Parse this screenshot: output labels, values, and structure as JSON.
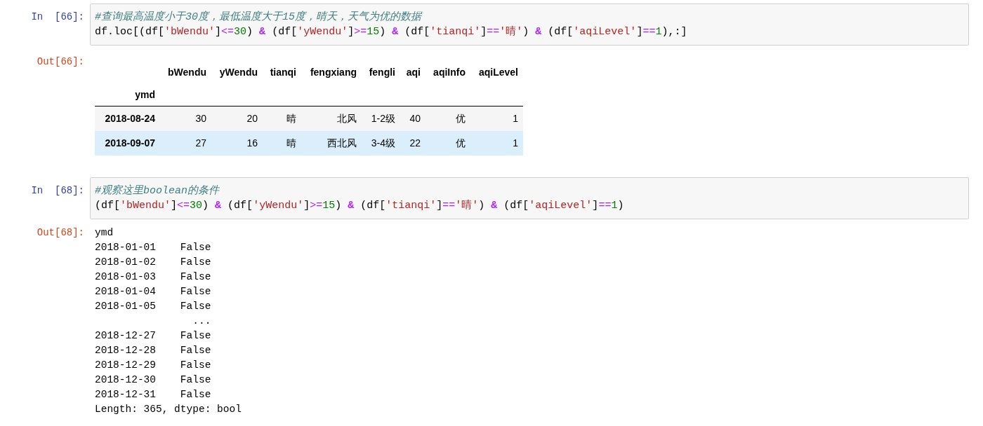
{
  "cells": [
    {
      "kind": "code",
      "prompt": "In  [66]:",
      "lines": [
        [
          {
            "kind": "comment",
            "text": "#查询最高温度小于30度，最低温度大于15度，晴天，天气为优的数据"
          }
        ],
        [
          {
            "kind": "plain",
            "text": "df.loc[(df["
          },
          {
            "kind": "string",
            "text": "'bWendu'"
          },
          {
            "kind": "plain",
            "text": "]"
          },
          {
            "kind": "op",
            "text": "<="
          },
          {
            "kind": "number",
            "text": "30"
          },
          {
            "kind": "plain",
            "text": ") "
          },
          {
            "kind": "amp",
            "text": "&"
          },
          {
            "kind": "plain",
            "text": " (df["
          },
          {
            "kind": "string",
            "text": "'yWendu'"
          },
          {
            "kind": "plain",
            "text": "]"
          },
          {
            "kind": "op",
            "text": ">="
          },
          {
            "kind": "number",
            "text": "15"
          },
          {
            "kind": "plain",
            "text": ") "
          },
          {
            "kind": "amp",
            "text": "&"
          },
          {
            "kind": "plain",
            "text": " (df["
          },
          {
            "kind": "string",
            "text": "'tianqi'"
          },
          {
            "kind": "plain",
            "text": "]"
          },
          {
            "kind": "op",
            "text": "=="
          },
          {
            "kind": "string",
            "text": "'晴'"
          },
          {
            "kind": "plain",
            "text": ") "
          },
          {
            "kind": "amp",
            "text": "&"
          },
          {
            "kind": "plain",
            "text": " (df["
          },
          {
            "kind": "string",
            "text": "'aqiLevel'"
          },
          {
            "kind": "plain",
            "text": "]"
          },
          {
            "kind": "op",
            "text": "=="
          },
          {
            "kind": "number",
            "text": "1"
          },
          {
            "kind": "plain",
            "text": "),:]"
          }
        ]
      ]
    },
    {
      "kind": "table",
      "prompt": "Out[66]:",
      "table": {
        "columns": [
          "bWendu",
          "yWendu",
          "tianqi",
          "fengxiang",
          "fengli",
          "aqi",
          "aqiInfo",
          "aqiLevel"
        ],
        "index_name": "ymd",
        "rows": [
          {
            "index": "2018-08-24",
            "highlighted": false,
            "cells": [
              "30",
              "20",
              "晴",
              "北风",
              "1-2级",
              "40",
              "优",
              "1"
            ]
          },
          {
            "index": "2018-09-07",
            "highlighted": true,
            "cells": [
              "27",
              "16",
              "晴",
              "西北风",
              "3-4级",
              "22",
              "优",
              "1"
            ]
          }
        ]
      }
    },
    {
      "kind": "code",
      "prompt": "In  [68]:",
      "lines": [
        [
          {
            "kind": "comment",
            "text": "#观察这里boolean的条件"
          }
        ],
        [
          {
            "kind": "plain",
            "text": "(df["
          },
          {
            "kind": "string",
            "text": "'bWendu'"
          },
          {
            "kind": "plain",
            "text": "]"
          },
          {
            "kind": "op",
            "text": "<="
          },
          {
            "kind": "number",
            "text": "30"
          },
          {
            "kind": "plain",
            "text": ") "
          },
          {
            "kind": "amp",
            "text": "&"
          },
          {
            "kind": "plain",
            "text": " (df["
          },
          {
            "kind": "string",
            "text": "'yWendu'"
          },
          {
            "kind": "plain",
            "text": "]"
          },
          {
            "kind": "op",
            "text": ">="
          },
          {
            "kind": "number",
            "text": "15"
          },
          {
            "kind": "plain",
            "text": ") "
          },
          {
            "kind": "amp",
            "text": "&"
          },
          {
            "kind": "plain",
            "text": " (df["
          },
          {
            "kind": "string",
            "text": "'tianqi'"
          },
          {
            "kind": "plain",
            "text": "]"
          },
          {
            "kind": "op",
            "text": "=="
          },
          {
            "kind": "string",
            "text": "'晴'"
          },
          {
            "kind": "plain",
            "text": ") "
          },
          {
            "kind": "amp",
            "text": "&"
          },
          {
            "kind": "plain",
            "text": " (df["
          },
          {
            "kind": "string",
            "text": "'aqiLevel'"
          },
          {
            "kind": "plain",
            "text": "]"
          },
          {
            "kind": "op",
            "text": "=="
          },
          {
            "kind": "number",
            "text": "1"
          },
          {
            "kind": "plain",
            "text": ")"
          }
        ]
      ]
    },
    {
      "kind": "text",
      "prompt": "Out[68]:",
      "lines": [
        "ymd",
        "2018-01-01    False",
        "2018-01-02    False",
        "2018-01-03    False",
        "2018-01-04    False",
        "2018-01-05    False",
        "                ...",
        "2018-12-27    False",
        "2018-12-28    False",
        "2018-12-29    False",
        "2018-12-30    False",
        "2018-12-31    False",
        "Length: 365, dtype: bool"
      ]
    }
  ]
}
